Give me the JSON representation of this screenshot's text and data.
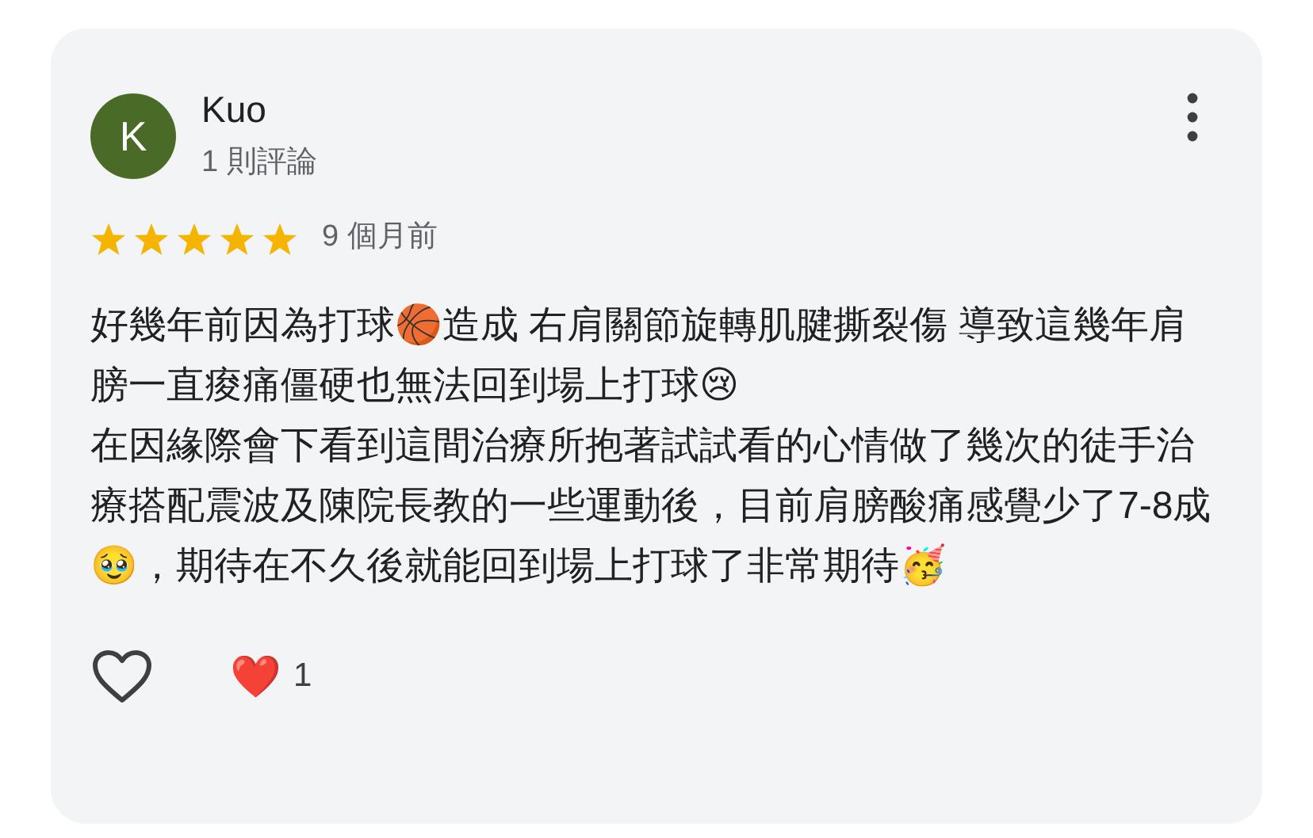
{
  "review": {
    "avatar_letter": "K",
    "author": "Kuo",
    "review_count": "1 則評論",
    "stars": 5,
    "time": "9 個月前",
    "paragraphs": [
      "好幾年前因為打球🏀造成 右肩關節旋轉肌腱撕裂傷 導致這幾年肩膀一直痠痛僵硬也無法回到場上打球😢",
      "在因緣際會下看到這間治療所抱著試試看的心情做了幾次的徒手治療搭配震波及陳院長教的一些運動後，目前肩膀酸痛感覺少了7-8成🥹，期待在不久後就能回到場上打球了非常期待🥳"
    ],
    "like": {
      "liked": false
    },
    "reactions": [
      {
        "emoji": "❤️",
        "count": "1"
      }
    ]
  }
}
